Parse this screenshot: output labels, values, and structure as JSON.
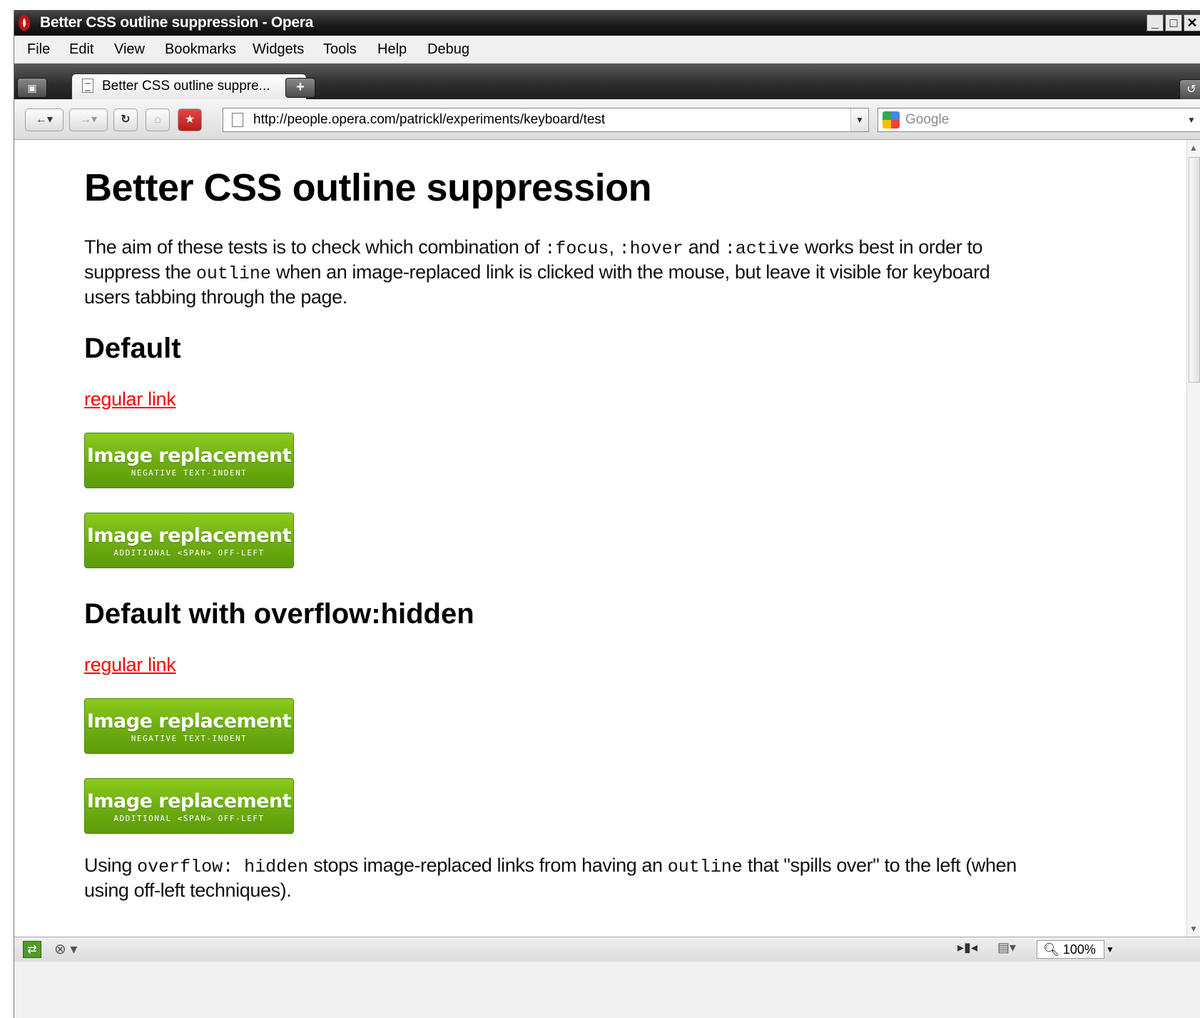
{
  "window": {
    "title": "Better CSS outline suppression - Opera",
    "controls": [
      "_",
      "□",
      "✕"
    ]
  },
  "menu": [
    "File",
    "Edit",
    "View",
    "Bookmarks",
    "Widgets",
    "Tools",
    "Help",
    "Debug"
  ],
  "tab": {
    "label": "Better CSS outline suppre...",
    "close": "✕",
    "new_tab": "+"
  },
  "nav": {
    "back": "←▾",
    "forward": "→▾",
    "reload": "↻",
    "url": "http://people.opera.com/patrickl/experiments/keyboard/test",
    "search_placeholder": "Google"
  },
  "page": {
    "title": "Better CSS outline suppression",
    "intro": {
      "t1": "The aim of these tests is to check which combination of ",
      "c1": ":focus",
      "t2": ", ",
      "c2": ":hover",
      "t3": " and ",
      "c3": ":active",
      "t4": " works best in order to suppress the ",
      "c4": "outline",
      "t5": " when an image-replaced link is clicked with the mouse, but leave it visible for keyboard users tabbing through the page."
    },
    "sections": [
      {
        "heading": "Default",
        "link": "regular link",
        "buttons": [
          {
            "main": "Image replacement",
            "sub": "NEGATIVE TEXT-INDENT"
          },
          {
            "main": "Image replacement",
            "sub": "ADDITIONAL <SPAN> OFF-LEFT"
          }
        ]
      },
      {
        "heading": "Default with overflow:hidden",
        "link": "regular link",
        "buttons": [
          {
            "main": "Image replacement",
            "sub": "NEGATIVE TEXT-INDENT"
          },
          {
            "main": "Image replacement",
            "sub": "ADDITIONAL <SPAN> OFF-LEFT"
          }
        ]
      }
    ],
    "footer": {
      "t1": "Using ",
      "c1": "overflow: hidden",
      "t2": " stops image-replaced links from having an ",
      "c2": "outline",
      "t3": " that \"spills over\" to the left (when using off-left techniques)."
    }
  },
  "status": {
    "zoom": "100%"
  },
  "colors": {
    "link": "#ff0000",
    "button_green": "#6fae12"
  }
}
